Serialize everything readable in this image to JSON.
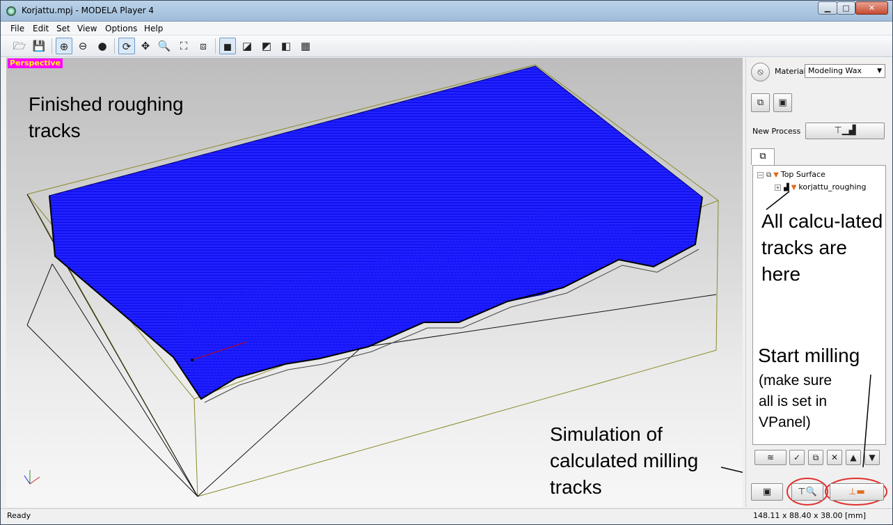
{
  "window": {
    "title": "Korjattu.mpj - MODELA Player 4",
    "min_label": "▁",
    "max_label": "□",
    "close_label": "✕"
  },
  "menu": [
    "File",
    "Edit",
    "Set",
    "View",
    "Options",
    "Help"
  ],
  "toolbar": {
    "icons": [
      "open-folder-icon",
      "save-icon",
      "wireframe-icon",
      "sphere-outline-icon",
      "sphere-shaded-icon",
      "rotate-icon",
      "move-icon",
      "zoom-icon",
      "fit-icon",
      "zoom-box-icon",
      "view-perspective-icon",
      "view-front-icon",
      "view-side-icon",
      "view-iso-icon",
      "view-grid-icon"
    ],
    "glyphs": [
      "🗁",
      "💾",
      "⊕",
      "⊖",
      "●",
      "⟳",
      "✥",
      "🔍",
      "⛶",
      "⧈",
      "◼",
      "◪",
      "◩",
      "◧",
      "▦"
    ]
  },
  "viewport": {
    "mode_label": "Perspective",
    "axis_label": "Y Z X"
  },
  "annotations": {
    "finished": "Finished roughing tracks",
    "simulation": "Simulation of calculated milling tracks",
    "calc": "All calcu-lated tracks are here",
    "start_title": "Start milling",
    "start_note": "(make sure all is set in VPanel)"
  },
  "panel": {
    "material_label": "Material",
    "material_value": "Modeling Wax",
    "new_process_label": "New Process",
    "tree": {
      "root": "Top Surface",
      "child": "korjattu_roughing"
    }
  },
  "status": {
    "left": "Ready",
    "right": "148.11 x 88.40 x 38.00 [mm]"
  },
  "colors": {
    "tracks": "#0000ff",
    "highlight_circle": "#e03030",
    "perspective_bg": "#ff00ff",
    "perspective_fg": "#ffff00"
  }
}
